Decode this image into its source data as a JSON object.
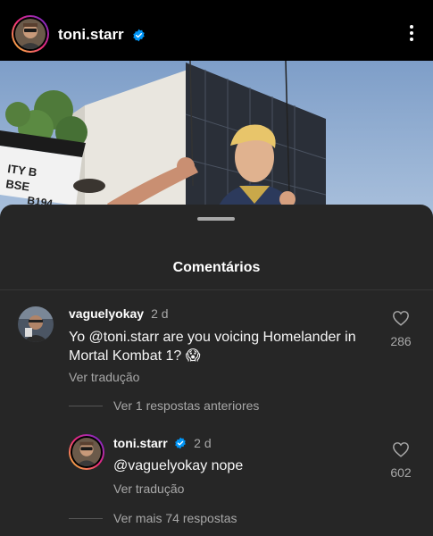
{
  "header": {
    "username": "toni.starr",
    "verified": true
  },
  "sheet": {
    "title": "Comentários"
  },
  "comments": [
    {
      "username": "vaguelyokay",
      "time": "2 d",
      "text": "Yo @toni.starr are you voicing Homelander in Mortal Kombat 1? 😱",
      "translate": "Ver tradução",
      "likes": "286"
    }
  ],
  "thread": {
    "previous": "Ver 1 respostas anteriores",
    "more": "Ver mais 74 respostas"
  },
  "reply": {
    "username": "toni.starr",
    "time": "2 d",
    "text": "@vaguelyokay nope",
    "translate": "Ver tradução",
    "likes": "602"
  },
  "colors": {
    "verified_blue": "#0095f6",
    "sheet_bg": "#262626",
    "secondary_text": "#a8a8a8"
  }
}
